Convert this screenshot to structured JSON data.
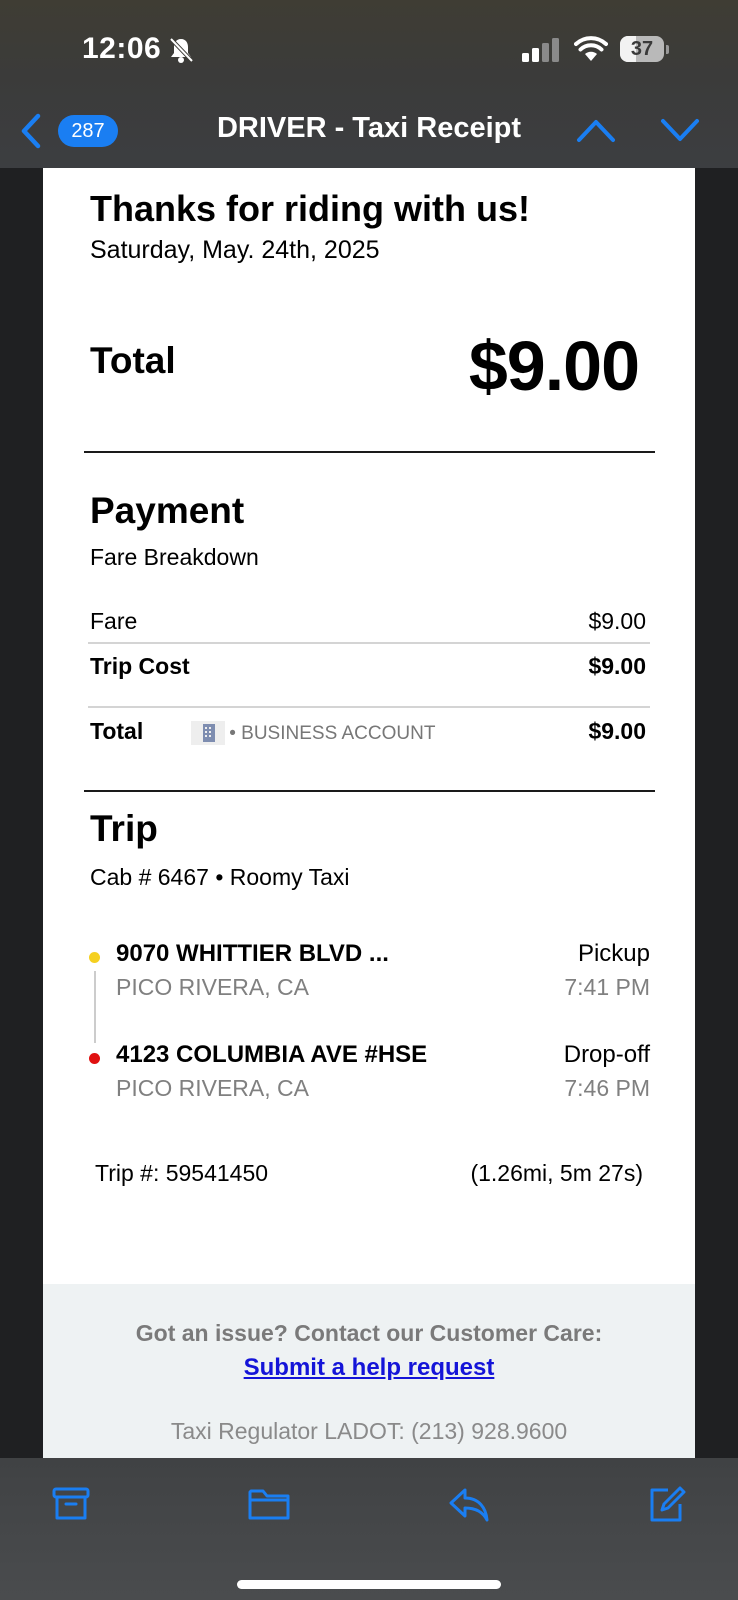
{
  "status_bar": {
    "time": "12:06",
    "battery": "37",
    "battery_level": 0.37
  },
  "nav": {
    "unread_count": "287",
    "title": "DRIVER - Taxi Receipt"
  },
  "receipt": {
    "thanks": "Thanks for riding with us!",
    "date": "Saturday, May. 24th, 2025",
    "total_label": "Total",
    "total_amount": "$9.00",
    "payment": {
      "title": "Payment",
      "subtitle": "Fare Breakdown",
      "fare_label": "Fare",
      "fare_value": "$9.00",
      "trip_cost_label": "Trip Cost",
      "trip_cost_value": "$9.00",
      "total_label": "Total",
      "account_text": "• BUSINESS ACCOUNT",
      "total_value": "$9.00"
    },
    "trip": {
      "title": "Trip",
      "cab_line": "Cab # 6467 • Roomy Taxi",
      "pickup": {
        "address": "9070 WHITTIER BLVD ...",
        "city": "PICO RIVERA, CA",
        "label": "Pickup",
        "time": "7:41 PM"
      },
      "dropoff": {
        "address": "4123 COLUMBIA AVE #HSE",
        "city": "PICO RIVERA, CA",
        "label": "Drop-off",
        "time": "7:46 PM"
      },
      "trip_number": "Trip #: 59541450",
      "distance": "(1.26mi, 5m 27s)"
    },
    "footer": {
      "care_text": "Got an issue? Contact our Customer Care:",
      "help_link": "Submit a help request",
      "regulator": "Taxi Regulator LADOT: (213) 928.9600"
    }
  },
  "colors": {
    "accent": "#1a7ef2",
    "pickup_dot": "#f5d020",
    "dropoff_dot": "#e01010",
    "link": "#1414d8"
  },
  "toolbar": {
    "icons": [
      "archive-icon",
      "folder-icon",
      "reply-icon",
      "compose-icon"
    ]
  }
}
